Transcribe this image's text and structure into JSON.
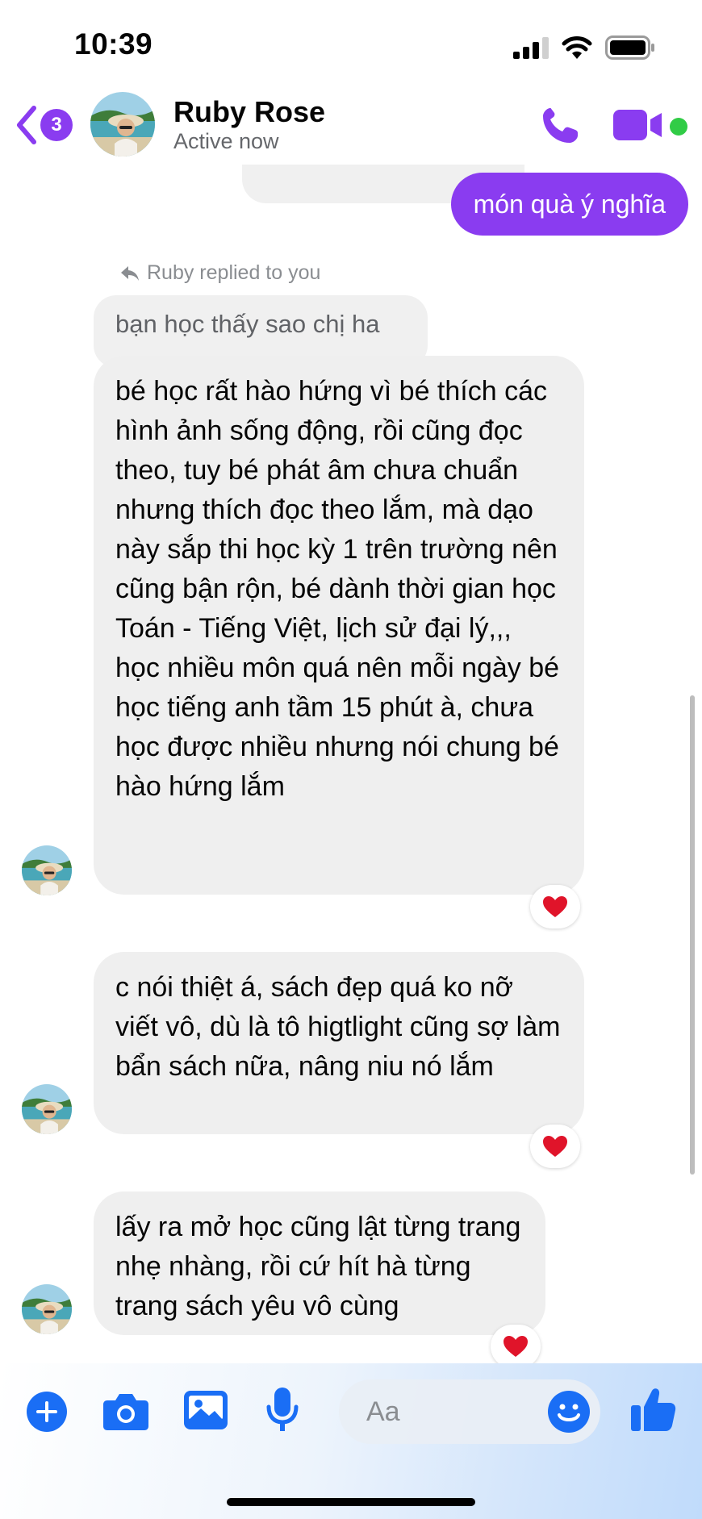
{
  "status_bar": {
    "time": "10:39"
  },
  "header": {
    "unread_count": "3",
    "contact_name": "Ruby Rose",
    "presence": "Active now"
  },
  "messages": {
    "outgoing_1": "món quà ý nghĩa",
    "reply_label": "Ruby replied to you",
    "quoted_text": "bạn học thấy sao chị ha",
    "incoming_1": "bé học rất hào hứng vì bé thích các hình ảnh sống động, rồi cũng đọc theo, tuy bé phát âm chưa chuẩn nhưng thích đọc theo lắm, mà dạo này sắp thi học kỳ 1 trên trường nên cũng bận rộn, bé dành thời gian học Toán - Tiếng Việt, lịch sử đại lý,,, học nhiều môn quá nên mỗi ngày bé học tiếng anh tầm 15 phút à, chưa học được nhiều nhưng nói chung bé hào hứng lắm",
    "incoming_2": "c nói thiệt á, sách đẹp quá ko nỡ viết vô, dù là tô higtlight cũng sợ làm bẩn sách nữa, nâng niu nó lắm",
    "incoming_3": "lấy ra mở học cũng lật từng trang nhẹ nhàng, rồi cứ hít hà từng trang sách yêu vô cùng",
    "reactions": [
      "heart",
      "heart",
      "heart"
    ]
  },
  "composer": {
    "placeholder": "Aa",
    "icons": [
      "plus-icon",
      "camera-icon",
      "gallery-icon",
      "microphone-icon",
      "emoji-icon",
      "thumbs-up-icon"
    ]
  },
  "colors": {
    "accent": "#8a3cf0",
    "blue": "#1a6ef5",
    "online": "#31cc46",
    "incoming_bubble": "#efefef",
    "heart": "#e0142a"
  }
}
